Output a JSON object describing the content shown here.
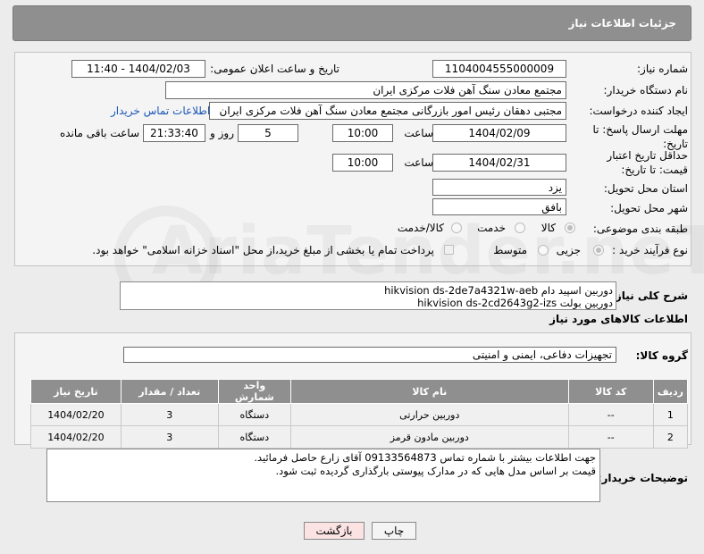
{
  "header": {
    "title": "جزئیات اطلاعات نیاز"
  },
  "form": {
    "need_number": {
      "label": "شماره نیاز:",
      "value": "1104004555000009"
    },
    "announce": {
      "label": "تاریخ و ساعت اعلان عمومی:",
      "value": "1404/02/03 - 11:40"
    },
    "buyer_org": {
      "label": "نام دستگاه خریدار:",
      "value": "مجتمع معادن سنگ آهن فلات مرکزی ایران"
    },
    "creator": {
      "label": "ایجاد کننده درخواست:",
      "value": "مجتبی  دهقان رئیس امور بازرگانی مجتمع معادن سنگ آهن فلات مرکزی ایران",
      "contact_link": "اطلاعات تماس خریدار"
    },
    "reply_deadline": {
      "label": "مهلت ارسال پاسخ: تا تاریخ:",
      "date": "1404/02/09",
      "time_label": "ساعت",
      "time": "10:00",
      "days": "5",
      "days_label": "روز و",
      "remaining": "21:33:40",
      "remaining_label": "ساعت باقی مانده"
    },
    "price_deadline": {
      "label": "حداقل تاریخ اعتبار قیمت: تا تاریخ:",
      "date": "1404/02/31",
      "time_label": "ساعت",
      "time": "10:00"
    },
    "province": {
      "label": "استان محل تحویل:",
      "value": "یزد"
    },
    "city": {
      "label": "شهر محل تحویل:",
      "value": "بافق"
    },
    "category": {
      "label": "طبقه بندی موضوعی:",
      "options": [
        "کالا",
        "خدمت",
        "کالا/خدمت"
      ]
    },
    "process": {
      "label": "نوع فرآیند خرید :",
      "options": [
        "جزیی",
        "متوسط"
      ],
      "payment_note": "پرداخت تمام یا بخشی از مبلغ خرید،از محل \"اسناد خزانه اسلامی\" خواهد بود."
    }
  },
  "description": {
    "label": "شرح کلی نیاز:",
    "line1": "دوربین اسپید دام hikvision ds-2de7a4321w-aeb",
    "line2": "دوربین بولت hikvision ds-2cd2643g2-izs"
  },
  "goods": {
    "section_title": "اطلاعات کالاهای مورد نیاز",
    "group_label": "گروه کالا:",
    "group_value": "تجهیزات دفاعی، ایمنی و امنیتی",
    "columns": [
      "ردیف",
      "کد کالا",
      "نام کالا",
      "واحد شمارش",
      "تعداد / مقدار",
      "تاریخ نیاز"
    ],
    "rows": [
      [
        "1",
        "--",
        "دوربین حرارتی",
        "دستگاه",
        "3",
        "1404/02/20"
      ],
      [
        "2",
        "--",
        "دوربین مادون قرمز",
        "دستگاه",
        "3",
        "1404/02/20"
      ]
    ]
  },
  "buyer_notes": {
    "label": "توضیحات خریدار:",
    "line1": "جهت اطلاعات بیشتر با شماره تماس 09133564873 آقای زارع حاصل فرمائید.",
    "line2": "قیمت بر اساس مدل هایی که در مدارک پیوستی بارگذاری گردیده ثبت شود."
  },
  "buttons": {
    "print": "چاپ",
    "back": "بازگشت"
  },
  "watermark": "AriaTender.neT"
}
